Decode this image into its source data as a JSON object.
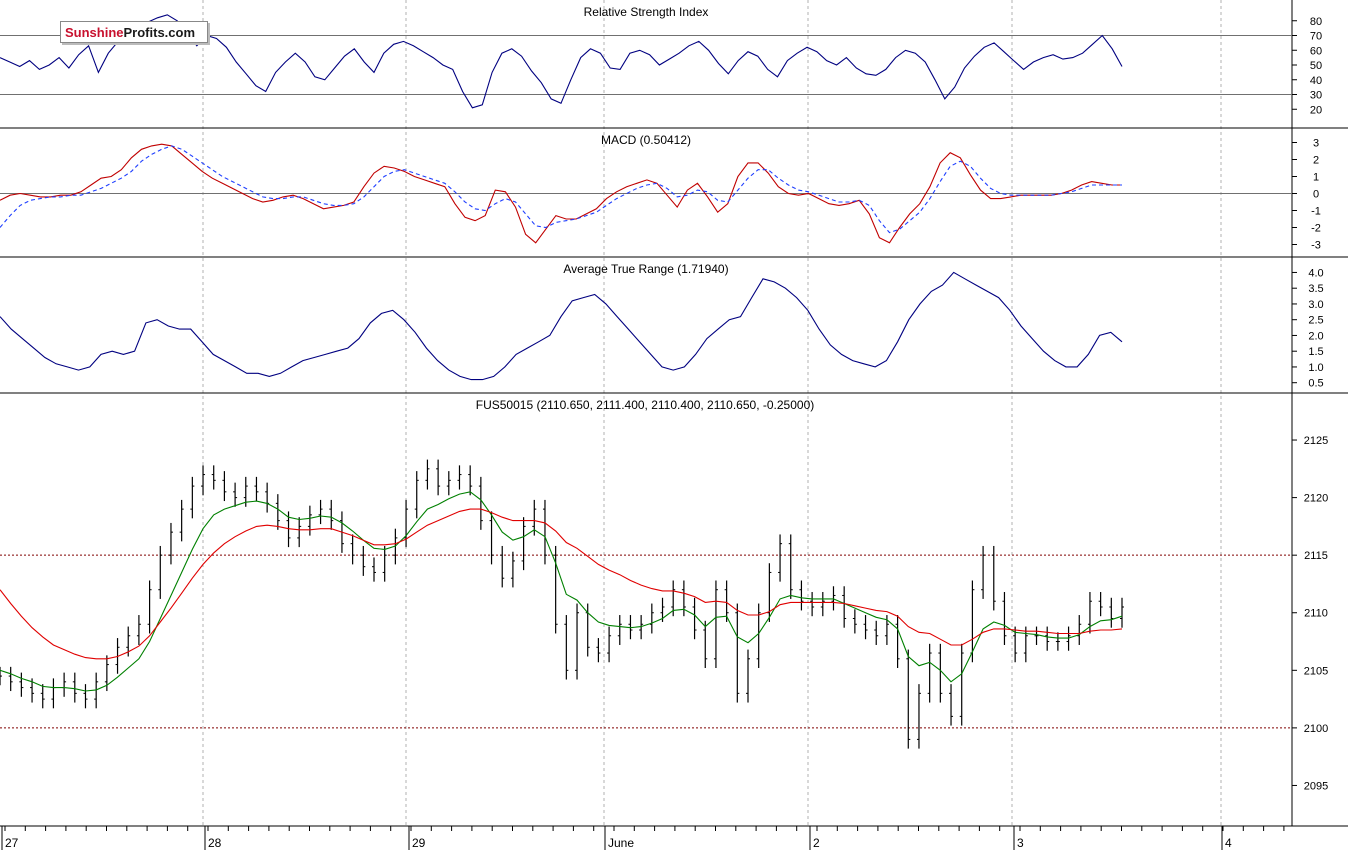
{
  "logo": {
    "part1": "Sunshine",
    "part2": "Profits.com"
  },
  "x_axis": {
    "labels": [
      "27",
      "28",
      "29",
      "June",
      "2",
      "3",
      "4"
    ]
  },
  "colors": {
    "price": "#000000",
    "ema_short": "#008000",
    "ema_long": "#e00000",
    "indicator": "#000080",
    "signal": "#1f3fff",
    "macd_line": "#c00000"
  },
  "chart_data": [
    {
      "type": "line",
      "title": "Relative Strength Index",
      "ylim": [
        10,
        90
      ],
      "y_ticks": [
        "20",
        "30",
        "40",
        "50",
        "60",
        "70",
        "80"
      ],
      "reference_lines": [
        30,
        70
      ],
      "series": [
        {
          "values": [
            55,
            52,
            49,
            53,
            47,
            50,
            55,
            48,
            57,
            63,
            45,
            58,
            66,
            70,
            75,
            79,
            82,
            84,
            80,
            72,
            63,
            70,
            68,
            62,
            52,
            44,
            36,
            32,
            45,
            52,
            58,
            52,
            42,
            40,
            48,
            56,
            61,
            52,
            45,
            58,
            64,
            66,
            63,
            59,
            55,
            50,
            47,
            32,
            21,
            23,
            45,
            58,
            61,
            56,
            46,
            38,
            27,
            24,
            40,
            55,
            61,
            58,
            48,
            47,
            58,
            60,
            57,
            50,
            54,
            58,
            63,
            66,
            60,
            51,
            44,
            53,
            59,
            56,
            47,
            42,
            53,
            58,
            62,
            59,
            53,
            50,
            55,
            48,
            44,
            43,
            47,
            55,
            60,
            58,
            52,
            40,
            27,
            35,
            48,
            56,
            62,
            65,
            59,
            53,
            47,
            52,
            55,
            57,
            54,
            55,
            58,
            64,
            70,
            61,
            49
          ]
        }
      ]
    },
    {
      "type": "line",
      "title": "MACD (0.50412)",
      "ylim": [
        -3.5,
        3.5
      ],
      "y_ticks": [
        "-3",
        "-2",
        "-1",
        "0",
        "1",
        "2",
        "3"
      ],
      "reference_lines": [
        0
      ],
      "series": [
        {
          "values": [
            -0.4,
            -0.1,
            0.0,
            -0.1,
            -0.2,
            -0.2,
            -0.1,
            -0.1,
            0.1,
            0.5,
            0.9,
            1.0,
            1.4,
            2.1,
            2.6,
            2.8,
            2.9,
            2.8,
            2.3,
            1.8,
            1.3,
            0.9,
            0.6,
            0.3,
            0.0,
            -0.3,
            -0.5,
            -0.4,
            -0.2,
            -0.1,
            -0.3,
            -0.6,
            -0.9,
            -0.8,
            -0.7,
            -0.5,
            0.4,
            1.2,
            1.6,
            1.5,
            1.3,
            1.0,
            0.8,
            0.6,
            0.4,
            -0.6,
            -1.4,
            -1.6,
            -1.3,
            0.2,
            0.1,
            -0.8,
            -2.4,
            -2.9,
            -2.1,
            -1.3,
            -1.5,
            -1.5,
            -1.2,
            -0.9,
            -0.3,
            0.1,
            0.4,
            0.6,
            0.8,
            0.6,
            -0.1,
            -0.8,
            0.2,
            0.6,
            -0.2,
            -1.1,
            -0.6,
            1.0,
            1.8,
            1.8,
            1.2,
            0.4,
            0.0,
            -0.1,
            0.0,
            -0.3,
            -0.6,
            -0.7,
            -0.6,
            -0.4,
            -1.2,
            -2.6,
            -2.9,
            -2.0,
            -1.2,
            -0.6,
            0.4,
            1.8,
            2.4,
            2.1,
            1.1,
            0.2,
            -0.3,
            -0.3,
            -0.2,
            -0.1,
            -0.1,
            -0.1,
            -0.1,
            0.0,
            0.2,
            0.5,
            0.7,
            0.6,
            0.5,
            0.5
          ]
        },
        {
          "values": [
            -2.0,
            -1.3,
            -0.7,
            -0.4,
            -0.3,
            -0.2,
            -0.2,
            -0.1,
            -0.1,
            0.1,
            0.3,
            0.6,
            0.9,
            1.3,
            1.9,
            2.3,
            2.6,
            2.8,
            2.6,
            2.2,
            1.8,
            1.4,
            1.0,
            0.7,
            0.4,
            0.1,
            -0.2,
            -0.3,
            -0.3,
            -0.2,
            -0.2,
            -0.4,
            -0.6,
            -0.7,
            -0.7,
            -0.6,
            -0.2,
            0.4,
            1.0,
            1.3,
            1.4,
            1.2,
            1.0,
            0.8,
            0.6,
            0.1,
            -0.5,
            -0.9,
            -1.0,
            -0.6,
            -0.3,
            -0.5,
            -1.2,
            -1.9,
            -2.0,
            -1.7,
            -1.6,
            -1.5,
            -1.3,
            -1.1,
            -0.7,
            -0.3,
            0.0,
            0.3,
            0.5,
            0.6,
            0.3,
            -0.2,
            -0.1,
            0.2,
            0.1,
            -0.4,
            -0.5,
            0.2,
            0.9,
            1.4,
            1.4,
            0.9,
            0.5,
            0.2,
            0.1,
            -0.1,
            -0.3,
            -0.5,
            -0.5,
            -0.4,
            -0.7,
            -1.6,
            -2.3,
            -2.1,
            -1.6,
            -1.1,
            -0.3,
            0.7,
            1.6,
            1.9,
            1.6,
            0.9,
            0.3,
            0.0,
            -0.1,
            -0.1,
            -0.1,
            -0.1,
            -0.1,
            0.0,
            0.1,
            0.3,
            0.5,
            0.5,
            0.5,
            0.5
          ]
        }
      ]
    },
    {
      "type": "line",
      "title": "Average True Range (1.71940)",
      "ylim": [
        0.3,
        4.3
      ],
      "y_ticks": [
        "0.5",
        "1.0",
        "1.5",
        "2.0",
        "2.5",
        "3.0",
        "3.5",
        "4.0"
      ],
      "series": [
        {
          "values": [
            2.6,
            2.2,
            1.9,
            1.6,
            1.3,
            1.1,
            1.0,
            0.9,
            1.0,
            1.4,
            1.5,
            1.4,
            1.5,
            2.4,
            2.5,
            2.3,
            2.2,
            2.2,
            1.8,
            1.4,
            1.2,
            1.0,
            0.8,
            0.8,
            0.7,
            0.8,
            1.0,
            1.2,
            1.3,
            1.4,
            1.5,
            1.6,
            1.9,
            2.4,
            2.7,
            2.8,
            2.5,
            2.1,
            1.6,
            1.2,
            0.9,
            0.7,
            0.6,
            0.6,
            0.7,
            1.0,
            1.4,
            1.6,
            1.8,
            2.0,
            2.6,
            3.1,
            3.2,
            3.3,
            3.0,
            2.6,
            2.2,
            1.8,
            1.4,
            1.0,
            0.9,
            1.0,
            1.4,
            1.9,
            2.2,
            2.5,
            2.6,
            3.2,
            3.8,
            3.7,
            3.5,
            3.2,
            2.8,
            2.2,
            1.7,
            1.4,
            1.2,
            1.1,
            1.0,
            1.2,
            1.8,
            2.5,
            3.0,
            3.4,
            3.6,
            4.0,
            3.8,
            3.6,
            3.4,
            3.2,
            2.8,
            2.3,
            1.9,
            1.5,
            1.2,
            1.0,
            1.0,
            1.4,
            2.0,
            2.1,
            1.8
          ]
        }
      ]
    },
    {
      "type": "line",
      "title": "FUS50015 (2110.650, 2111.400, 2110.400, 2110.650, -0.25000)",
      "ylim": [
        2092,
        2127
      ],
      "y_ticks": [
        "2095",
        "2100",
        "2105",
        "2110",
        "2115",
        "2120",
        "2125"
      ],
      "reference_lines": [
        2100,
        2115
      ],
      "series": [
        {
          "values": [
            2104.5,
            2104.0,
            2103.5,
            2103.0,
            2102.5,
            2103.5,
            2104.0,
            2103.0,
            2102.5,
            2104.0,
            2105.5,
            2107.0,
            2108.0,
            2109.0,
            2112.0,
            2115.0,
            2117.0,
            2119.0,
            2121.0,
            2122.0,
            2121.5,
            2120.5,
            2120.0,
            2121.0,
            2120.5,
            2119.5,
            2118.0,
            2116.5,
            2117.5,
            2118.5,
            2119.0,
            2118.0,
            2116.0,
            2115.0,
            2114.0,
            2113.5,
            2115.0,
            2116.5,
            2119.0,
            2121.5,
            2122.5,
            2121.0,
            2121.5,
            2122.0,
            2121.0,
            2118.0,
            2115.0,
            2113.0,
            2114.5,
            2117.5,
            2119.0,
            2115.0,
            2109.0,
            2105.0,
            2110.0,
            2107.0,
            2106.5,
            2108.0,
            2109.0,
            2108.5,
            2109.0,
            2110.0,
            2110.5,
            2112.0,
            2110.5,
            2108.5,
            2106.0,
            2112.0,
            2110.0,
            2103.0,
            2106.0,
            2110.0,
            2113.5,
            2116.0,
            2112.0,
            2111.0,
            2110.5,
            2111.0,
            2111.5,
            2109.5,
            2109.0,
            2108.5,
            2108.0,
            2109.0,
            2106.0,
            2099.0,
            2103.0,
            2106.5,
            2103.0,
            2101.0,
            2106.5,
            2112.0,
            2115.0,
            2111.0,
            2108.0,
            2106.5,
            2108.0,
            2108.0,
            2107.5,
            2107.5,
            2108.0,
            2109.0,
            2111.0,
            2110.5,
            2109.5,
            2110.5
          ]
        },
        {
          "values": [
            2105.0,
            2104.7,
            2104.3,
            2104.0,
            2103.6,
            2103.5,
            2103.5,
            2103.4,
            2103.2,
            2103.3,
            2103.7,
            2104.4,
            2105.2,
            2106.0,
            2107.5,
            2109.5,
            2111.5,
            2113.5,
            2115.5,
            2117.3,
            2118.5,
            2119.0,
            2119.3,
            2119.6,
            2119.7,
            2119.5,
            2119.0,
            2118.3,
            2118.1,
            2118.2,
            2118.4,
            2118.3,
            2117.8,
            2117.1,
            2116.3,
            2115.6,
            2115.5,
            2115.8,
            2116.7,
            2117.9,
            2119.0,
            2119.4,
            2119.9,
            2120.3,
            2120.5,
            2119.8,
            2118.5,
            2117.0,
            2116.3,
            2116.6,
            2117.2,
            2116.6,
            2114.3,
            2111.6,
            2111.1,
            2110.0,
            2109.2,
            2108.9,
            2108.8,
            2108.7,
            2108.8,
            2109.1,
            2109.5,
            2110.2,
            2110.3,
            2109.8,
            2108.8,
            2109.6,
            2109.7,
            2107.9,
            2107.4,
            2108.2,
            2109.6,
            2111.2,
            2111.5,
            2111.3,
            2111.2,
            2111.2,
            2111.2,
            2110.8,
            2110.4,
            2110.0,
            2109.6,
            2109.4,
            2108.6,
            2106.2,
            2105.4,
            2105.7,
            2105.0,
            2104.0,
            2104.7,
            2106.6,
            2108.6,
            2109.2,
            2108.9,
            2108.3,
            2108.2,
            2108.1,
            2107.9,
            2107.8,
            2107.8,
            2108.1,
            2108.8,
            2109.3,
            2109.4,
            2109.7
          ]
        },
        {
          "values": [
            2112.0,
            2110.8,
            2109.7,
            2108.7,
            2107.9,
            2107.2,
            2106.8,
            2106.4,
            2106.1,
            2106.0,
            2106.0,
            2106.2,
            2106.6,
            2107.1,
            2108.0,
            2109.2,
            2110.4,
            2111.7,
            2113.0,
            2114.2,
            2115.2,
            2116.0,
            2116.6,
            2117.1,
            2117.5,
            2117.6,
            2117.5,
            2117.3,
            2117.2,
            2117.2,
            2117.3,
            2117.3,
            2117.0,
            2116.7,
            2116.3,
            2115.9,
            2115.9,
            2116.0,
            2116.4,
            2117.0,
            2117.6,
            2118.0,
            2118.4,
            2118.8,
            2119.0,
            2119.0,
            2118.7,
            2118.3,
            2118.0,
            2118.0,
            2118.0,
            2117.8,
            2117.1,
            2116.1,
            2115.6,
            2114.9,
            2114.2,
            2113.7,
            2113.3,
            2112.8,
            2112.4,
            2112.1,
            2111.9,
            2111.9,
            2111.7,
            2111.4,
            2110.9,
            2111.0,
            2110.9,
            2110.2,
            2109.8,
            2109.8,
            2110.1,
            2110.7,
            2110.9,
            2110.9,
            2110.9,
            2110.9,
            2110.9,
            2110.8,
            2110.6,
            2110.4,
            2110.2,
            2110.1,
            2109.7,
            2108.8,
            2108.3,
            2108.2,
            2107.7,
            2107.2,
            2107.2,
            2107.7,
            2108.3,
            2108.6,
            2108.6,
            2108.5,
            2108.4,
            2108.4,
            2108.3,
            2108.2,
            2108.2,
            2108.2,
            2108.4,
            2108.5,
            2108.5,
            2108.6
          ]
        }
      ]
    }
  ]
}
